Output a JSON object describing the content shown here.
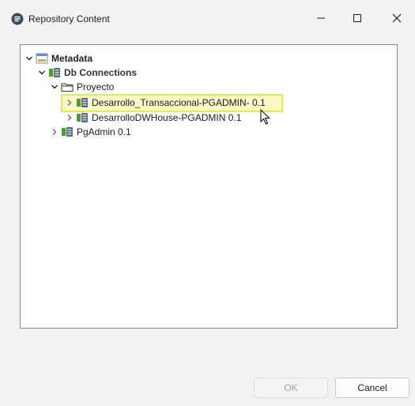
{
  "window": {
    "title": "Repository Content",
    "controls": {
      "minimize": "–",
      "maximize": "□",
      "close": "✕"
    }
  },
  "tree": {
    "root": {
      "label": "Metadata",
      "icon": "metadata-folder-icon",
      "expanded": true
    },
    "db_connections": {
      "label": "Db Connections",
      "icon": "db-connections-icon",
      "expanded": true
    },
    "proyecto": {
      "label": "Proyecto",
      "icon": "folder-open-icon",
      "expanded": true
    },
    "items": [
      {
        "label": "Desarrollo_Transaccional-PGADMIN- 0.1",
        "icon": "db-connection-icon",
        "expanded": false,
        "selected": true
      },
      {
        "label": "DesarrolloDWHouse-PGADMIN 0.1",
        "icon": "db-connection-icon",
        "expanded": false,
        "selected": false
      }
    ],
    "pgadmin": {
      "label": "PgAdmin 0.1",
      "icon": "db-connection-icon",
      "expanded": false
    }
  },
  "buttons": {
    "ok": "OK",
    "cancel": "Cancel"
  },
  "colors": {
    "highlight_border": "#e8e84a",
    "highlight_fill": "#f8f8c8",
    "panel_border": "#828790"
  }
}
